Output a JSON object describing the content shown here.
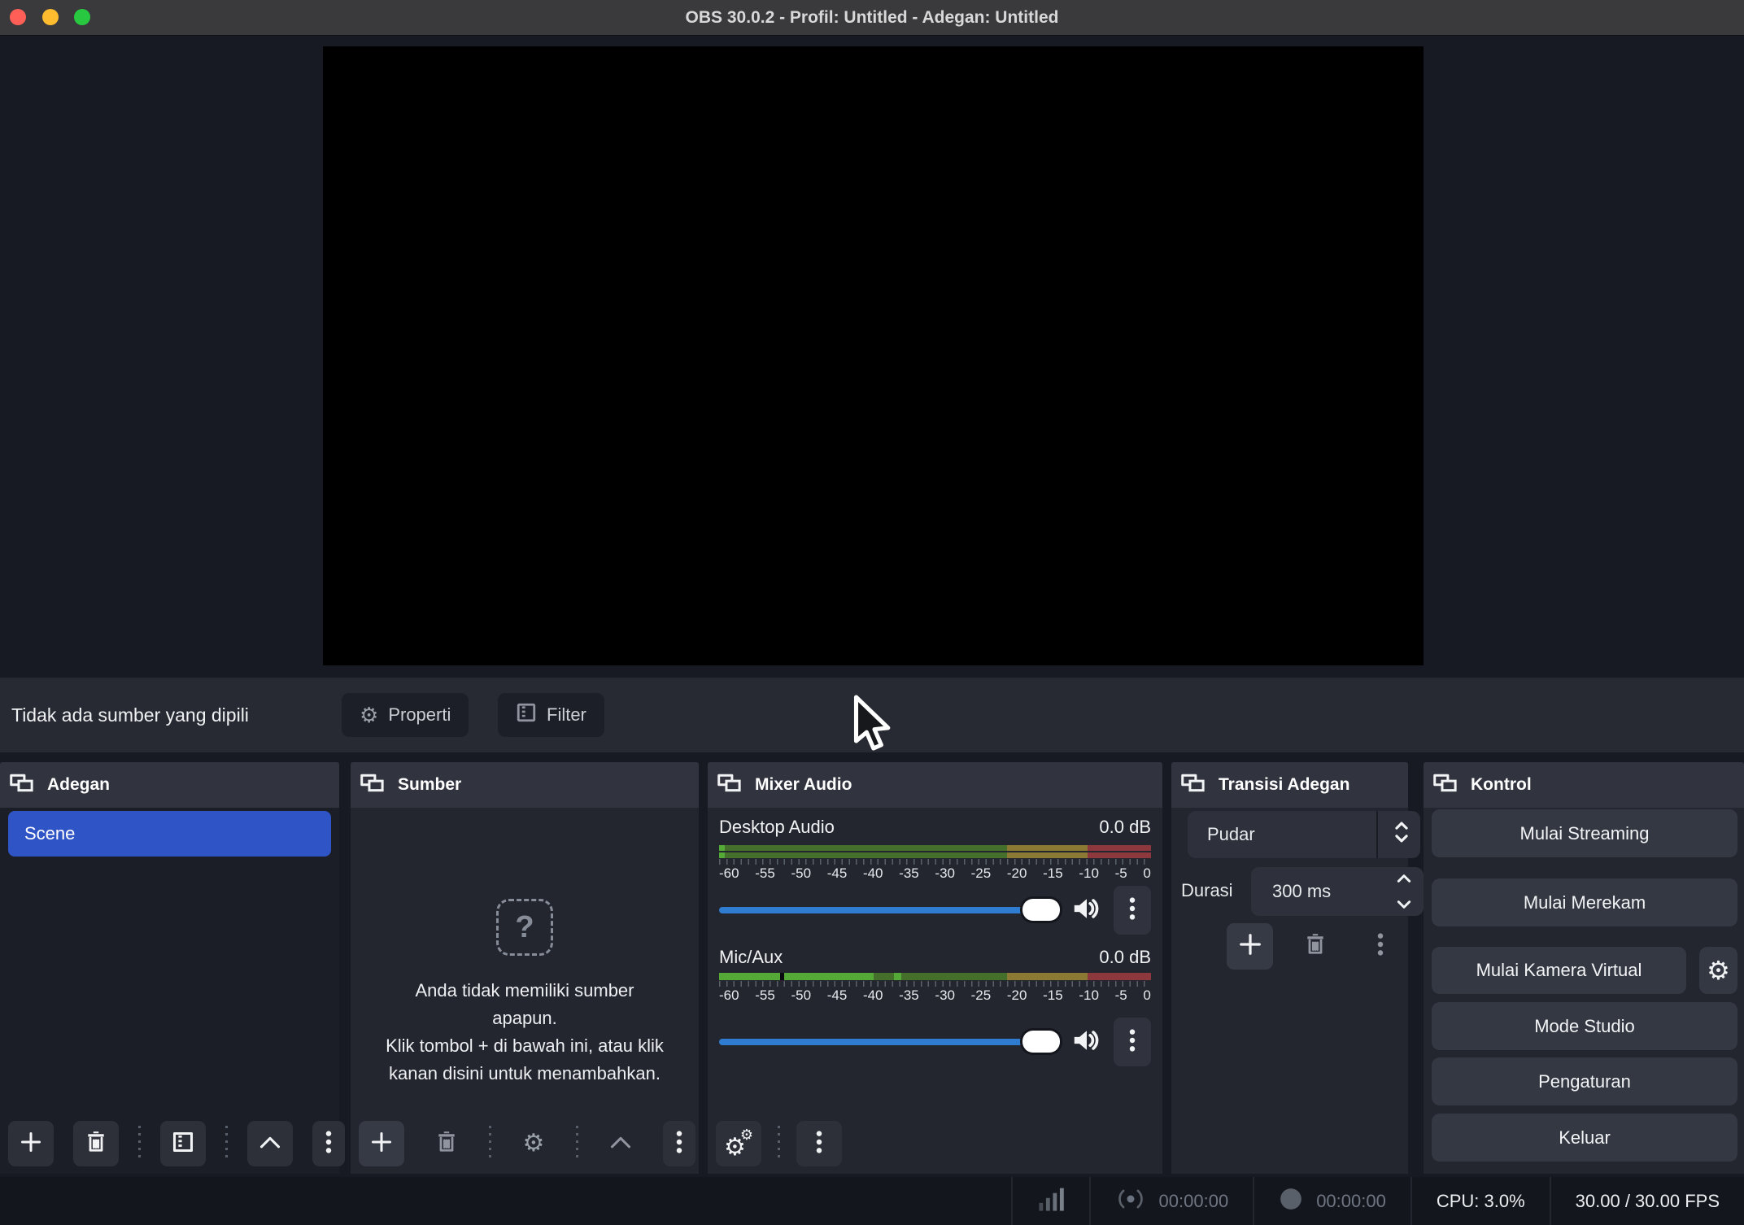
{
  "window": {
    "title": "OBS 30.0.2 - Profil: Untitled - Adegan: Untitled"
  },
  "source_toolbar": {
    "status": "Tidak ada sumber yang dipili",
    "properties": "Properti",
    "filter": "Filter"
  },
  "scenes": {
    "title": "Adegan",
    "selected_scene": "Scene"
  },
  "sources": {
    "title": "Sumber",
    "empty_line1": "Anda tidak memiliki sumber apapun.",
    "empty_line2": "Klik tombol + di bawah ini, atau klik kanan disini untuk menambahkan."
  },
  "mixer": {
    "title": "Mixer Audio",
    "desktop": {
      "name": "Desktop Audio",
      "level": "0.0 dB"
    },
    "mic": {
      "name": "Mic/Aux",
      "level": "0.0 dB"
    },
    "scale": [
      "-60",
      "-55",
      "-50",
      "-45",
      "-40",
      "-35",
      "-30",
      "-25",
      "-20",
      "-15",
      "-10",
      "-5",
      "0"
    ]
  },
  "transitions": {
    "title": "Transisi Adegan",
    "current": "Pudar",
    "duration_label": "Durasi",
    "duration": "300 ms"
  },
  "controls": {
    "title": "Kontrol",
    "start_streaming": "Mulai Streaming",
    "start_recording": "Mulai Merekam",
    "start_virtual_camera": "Mulai Kamera Virtual",
    "studio_mode": "Mode Studio",
    "settings": "Pengaturan",
    "exit": "Keluar"
  },
  "statusbar": {
    "stream_time": "00:00:00",
    "record_time": "00:00:00",
    "cpu": "CPU: 3.0%",
    "fps": "30.00 / 30.00 FPS"
  },
  "colors": {
    "titlebar": "#3A3A3C",
    "window_bg": "#181A23",
    "panel_header": "#31343E",
    "panel_body": "#24262F",
    "accent_blue_selected": "#2F54C5",
    "slider_blue": "#2E7DD1",
    "meter_green_bright": "#54A937",
    "meter_green_dim": "#44702B",
    "meter_yellow_dim": "#8A7A34",
    "meter_red_dim": "#8C383C",
    "traffic_red": "#FF5F57",
    "traffic_yellow": "#FEBC2E",
    "traffic_green": "#28C840"
  },
  "icons": {
    "panel_header": "overlapping-windows",
    "properties": "gear",
    "filter": "striped-square",
    "add": "plus",
    "remove": "trash",
    "move_up": "chevron-up",
    "menu": "kebab-dots",
    "advanced_audio": "double-gear",
    "volume": "speaker",
    "sources_empty": "question-mark",
    "network": "signal-bars",
    "stream_status": "broadcast",
    "record_status": "record-circle",
    "pointer": "arrow-cursor"
  }
}
